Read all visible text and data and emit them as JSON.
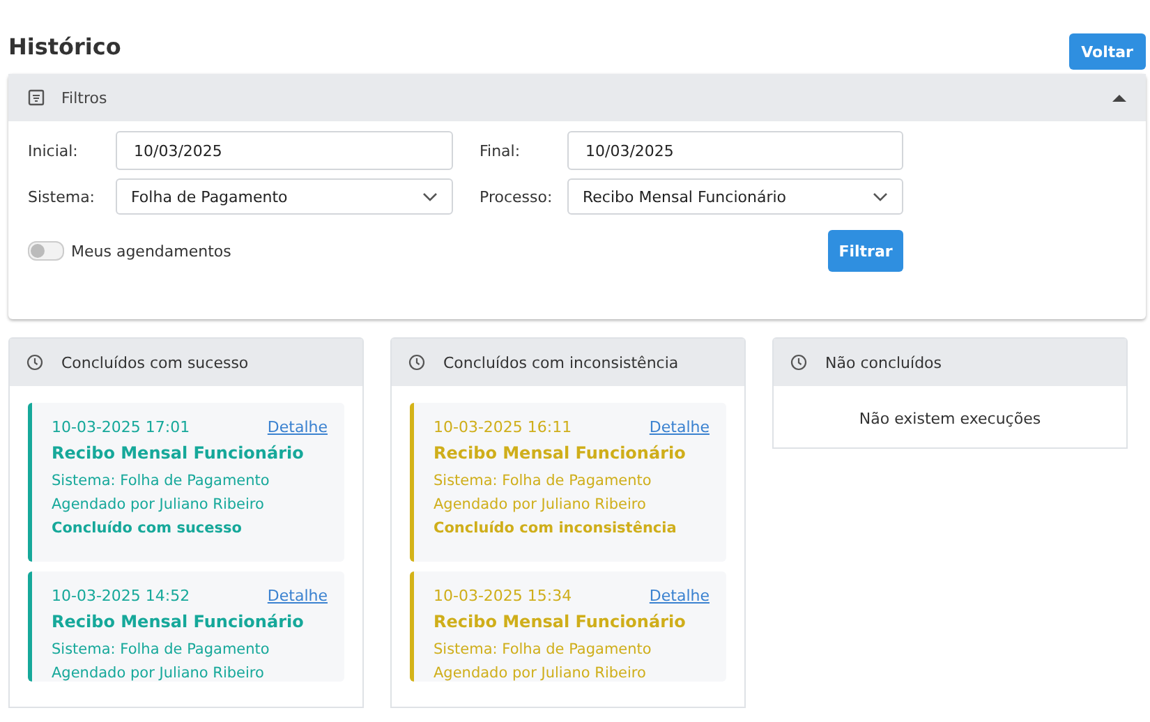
{
  "page": {
    "title": "Histórico",
    "back_button": "Voltar"
  },
  "filters": {
    "title": "Filtros",
    "expanded": true,
    "fields": [
      {
        "kind": "text",
        "label": "Inicial:",
        "value": "10/03/2025"
      },
      {
        "kind": "text",
        "label": "Final:",
        "value": "10/03/2025"
      },
      {
        "kind": "select",
        "label": "Sistema:",
        "value": "Folha de Pagamento"
      },
      {
        "kind": "select",
        "label": "Processo:",
        "value": "Recibo Mensal Funcionário"
      }
    ],
    "toggle": {
      "label": "Meus agendamentos",
      "on": false
    },
    "submit_button": "Filtrar"
  },
  "columns": [
    {
      "title": "Concluídos com sucesso",
      "kind": "success",
      "cards": [
        {
          "datetime": "10-03-2025 17:01",
          "link": "Detalhe",
          "process": "Recibo Mensal Funcionário",
          "system": "Sistema: Folha de Pagamento",
          "scheduled_by": "Agendado por Juliano Ribeiro",
          "status": "Concluído com sucesso"
        },
        {
          "datetime": "10-03-2025 14:52",
          "link": "Detalhe",
          "process": "Recibo Mensal Funcionário",
          "system": "Sistema: Folha de Pagamento",
          "scheduled_by": "Agendado por Juliano Ribeiro"
        }
      ]
    },
    {
      "title": "Concluídos com inconsistência",
      "kind": "warning",
      "cards": [
        {
          "datetime": "10-03-2025 16:11",
          "link": "Detalhe",
          "process": "Recibo Mensal Funcionário",
          "system": "Sistema: Folha de Pagamento",
          "scheduled_by": "Agendado por Juliano Ribeiro",
          "status": "Concluído com inconsistência"
        },
        {
          "datetime": "10-03-2025 15:34",
          "link": "Detalhe",
          "process": "Recibo Mensal Funcionário",
          "system": "Sistema: Folha de Pagamento",
          "scheduled_by": "Agendado por Juliano Ribeiro"
        }
      ]
    },
    {
      "title": "Não concluídos",
      "kind": "empty",
      "message": "Não existem execuções"
    }
  ]
}
